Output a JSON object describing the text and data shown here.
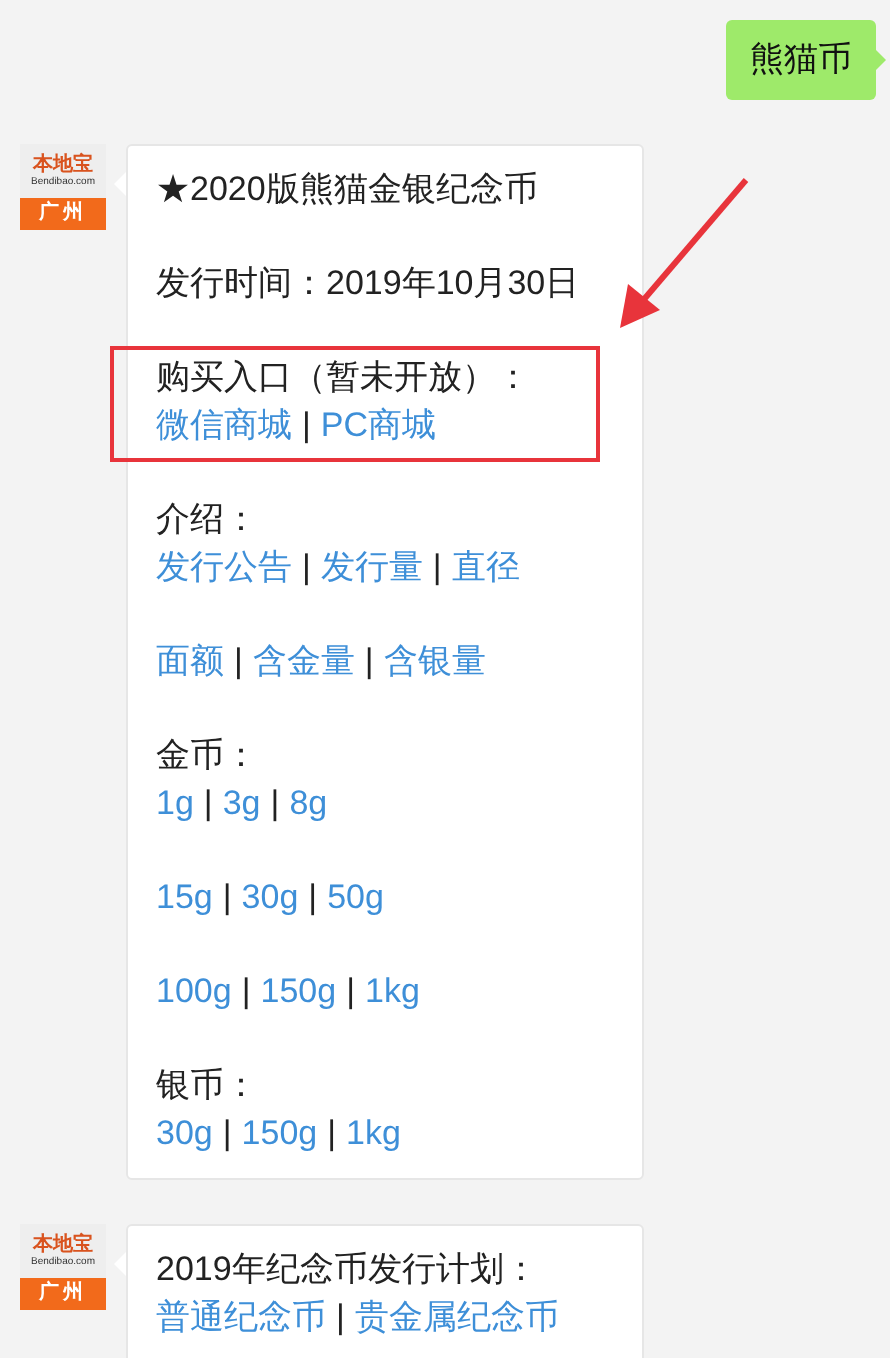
{
  "messages": [
    {
      "kind": "sent",
      "text": "熊猫币"
    },
    {
      "kind": "received",
      "avatar": {
        "logo": "本地宝",
        "site": "Bendibao.com",
        "city": "广州"
      },
      "separator": "|",
      "blocks": [
        {
          "heading": "★2020版熊猫金银纪念币",
          "highlighted": false
        },
        {
          "heading": "发行时间：2019年10月30日",
          "highlighted": false
        },
        {
          "heading": "购买入口（暂未开放）：",
          "links": [
            "微信商城",
            "PC商城"
          ],
          "highlighted": true
        },
        {
          "heading": "介绍：",
          "links": [
            "发行公告",
            "发行量",
            "直径"
          ],
          "highlighted": false
        },
        {
          "links": [
            "面额",
            "含金量",
            "含银量"
          ],
          "highlighted": false
        },
        {
          "heading": "金币：",
          "links": [
            "1g",
            "3g",
            "8g"
          ],
          "highlighted": false
        },
        {
          "links": [
            "15g",
            "30g",
            "50g"
          ],
          "highlighted": false
        },
        {
          "links": [
            "100g",
            "150g",
            "1kg"
          ],
          "highlighted": false
        },
        {
          "heading": "银币：",
          "links": [
            "30g",
            "150g",
            "1kg"
          ],
          "highlighted": false
        }
      ]
    },
    {
      "kind": "received",
      "avatar": {
        "logo": "本地宝",
        "site": "Bendibao.com",
        "city": "广州"
      },
      "separator": "|",
      "blocks": [
        {
          "heading": "2019年纪念币发行计划：",
          "links": [
            "普通纪念币",
            "贵金属纪念币"
          ],
          "highlighted": false
        }
      ]
    }
  ]
}
